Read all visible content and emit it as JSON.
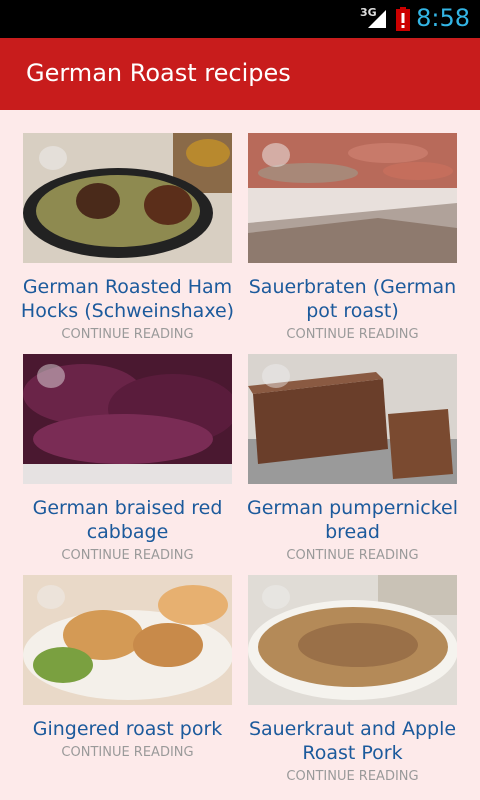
{
  "status_bar": {
    "network": "3G",
    "time": "8:58",
    "icons": [
      "signal-icon",
      "battery-alert-icon"
    ]
  },
  "action_bar": {
    "title": "German Roast recipes"
  },
  "recipes": [
    {
      "title": "German Roasted Ham Hocks (Schweinshaxe)",
      "action": "CONTINUE READING"
    },
    {
      "title": "Sauerbraten (German pot roast)",
      "action": "CONTINUE READING"
    },
    {
      "title": "German braised red cabbage",
      "action": "CONTINUE READING"
    },
    {
      "title": "German pumpernickel bread",
      "action": "CONTINUE READING"
    },
    {
      "title": "Gingered roast pork",
      "action": "CONTINUE READING"
    },
    {
      "title": "Sauerkraut and Apple Roast Pork",
      "action": "CONTINUE READING"
    }
  ],
  "colors": {
    "action_bar": "#c81c1c",
    "title_link": "#1c5a9c",
    "background": "#fdeaea",
    "clock": "#33b5e5"
  }
}
